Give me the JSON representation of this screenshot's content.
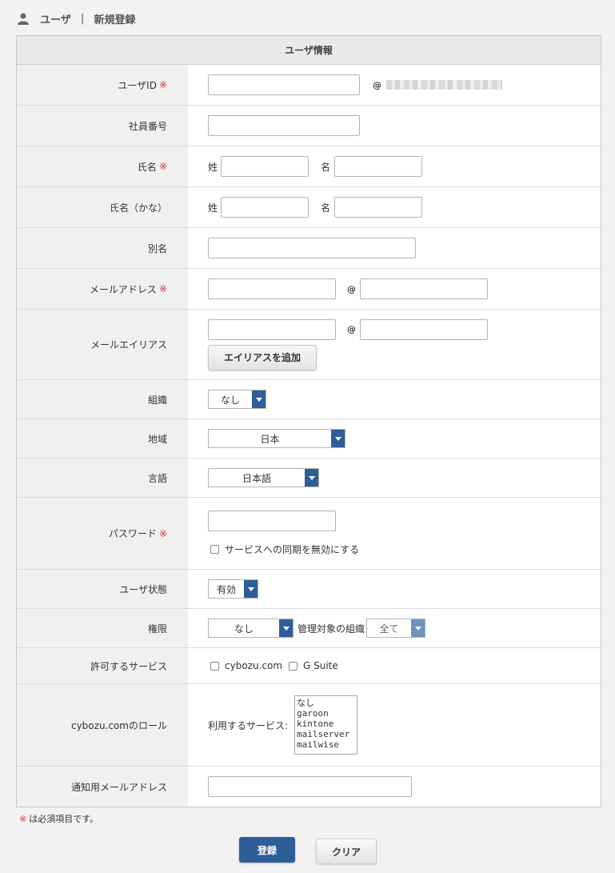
{
  "header": {
    "section": "ユーザ",
    "separator": "|",
    "title": "新規登録"
  },
  "form": {
    "title": "ユーザ情報",
    "required_mark": "※",
    "user_id": {
      "label": "ユーザID",
      "value": "",
      "at": "@"
    },
    "employee_number": {
      "label": "社員番号",
      "value": ""
    },
    "name": {
      "label": "氏名",
      "last_label": "姓",
      "first_label": "名"
    },
    "name_kana": {
      "label": "氏名（かな）",
      "last_label": "姓",
      "first_label": "名"
    },
    "alias": {
      "label": "別名"
    },
    "email": {
      "label": "メールアドレス",
      "at": "@"
    },
    "email_alias": {
      "label": "メールエイリアス",
      "at": "@",
      "add_button": "エイリアスを追加"
    },
    "organization": {
      "label": "組織",
      "selected": "なし"
    },
    "region": {
      "label": "地域",
      "selected": "日本"
    },
    "language": {
      "label": "言語",
      "selected": "日本語"
    },
    "password": {
      "label": "パスワード",
      "sync_disable_label": "サービスへの同期を無効にする"
    },
    "user_status": {
      "label": "ユーザ状態",
      "selected": "有効"
    },
    "permission": {
      "label": "権限",
      "selected": "なし",
      "managed_org_label": "管理対象の組織",
      "managed_org_selected": "全て"
    },
    "allowed_services": {
      "label": "許可するサービス",
      "options": [
        "cybozu.com",
        "G Suite"
      ]
    },
    "cybozu_role": {
      "label": "cybozu.comのロール",
      "services_label": "利用するサービス:",
      "services": [
        "なし",
        "garoon",
        "kintone",
        "mailserver",
        "mailwise"
      ]
    },
    "notify_email": {
      "label": "通知用メールアドレス"
    }
  },
  "footer": {
    "note": "は必須項目です。",
    "submit": "登録",
    "clear": "クリア"
  },
  "colors": {
    "primary": "#2e5e97",
    "required": "#d9303b"
  }
}
